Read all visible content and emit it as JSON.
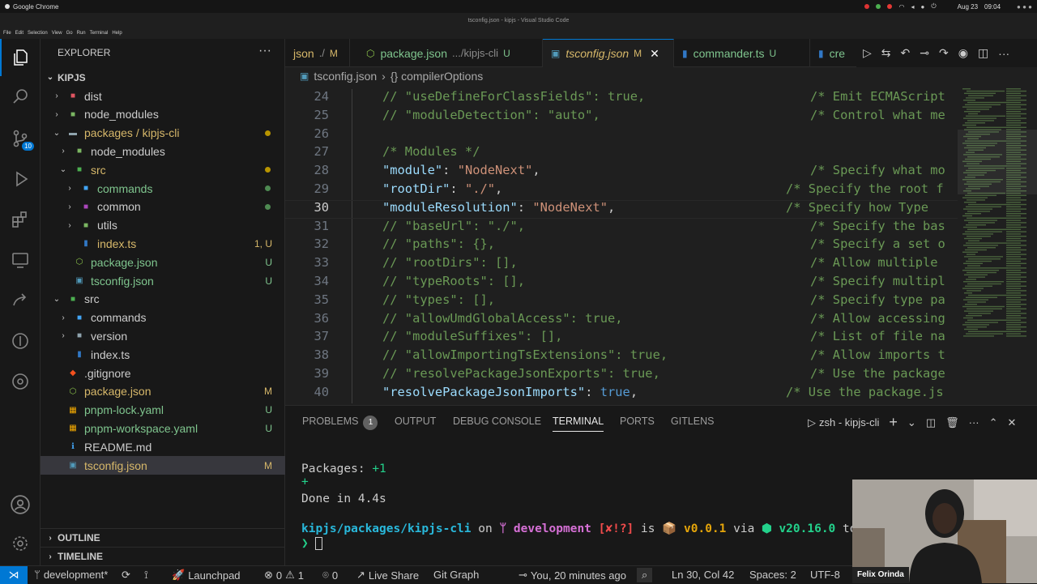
{
  "os": {
    "app": "Google Chrome",
    "date": "Aug 23",
    "time": "09:04"
  },
  "window_title": "tsconfig.json - kipjs - Visual Studio Code",
  "menu": [
    "File",
    "Edit",
    "Selection",
    "View",
    "Go",
    "Run",
    "Terminal",
    "Help"
  ],
  "activity": {
    "scm_badge": "10"
  },
  "explorer": {
    "title": "EXPLORER",
    "more": "···",
    "root": "KIPJS",
    "rows": [
      {
        "label": "dist",
        "depth": 1,
        "chev": "›",
        "icon": "folder-red",
        "color": "#cccccc",
        "status": ""
      },
      {
        "label": "node_modules",
        "depth": 1,
        "chev": "›",
        "icon": "folder-green",
        "color": "#cccccc",
        "status": ""
      },
      {
        "label": "packages / kipjs-cli",
        "depth": 1,
        "chev": "⌄",
        "icon": "folder-open",
        "color": "#d7b86a",
        "status": "dot"
      },
      {
        "label": "node_modules",
        "depth": 2,
        "chev": "›",
        "icon": "folder-green",
        "color": "#cccccc",
        "status": ""
      },
      {
        "label": "src",
        "depth": 2,
        "chev": "⌄",
        "icon": "folder-src",
        "color": "#d7b86a",
        "status": "dot"
      },
      {
        "label": "commands",
        "depth": 3,
        "chev": "›",
        "icon": "folder-blue",
        "color": "#7fc58e",
        "status": "dot-green"
      },
      {
        "label": "common",
        "depth": 3,
        "chev": "›",
        "icon": "folder-purple",
        "color": "#cccccc",
        "status": "dot-green"
      },
      {
        "label": "utils",
        "depth": 3,
        "chev": "›",
        "icon": "folder-green",
        "color": "#cccccc",
        "status": ""
      },
      {
        "label": "index.ts",
        "depth": 3,
        "chev": "",
        "icon": "ts",
        "color": "#d7b86a",
        "status": "1, U"
      },
      {
        "label": "package.json",
        "depth": 2,
        "chev": "",
        "icon": "nodejs",
        "color": "#7fc58e",
        "status": "U"
      },
      {
        "label": "tsconfig.json",
        "depth": 2,
        "chev": "",
        "icon": "tsconfig",
        "color": "#7fc58e",
        "status": "U"
      },
      {
        "label": "src",
        "depth": 1,
        "chev": "⌄",
        "icon": "folder-src",
        "color": "#cccccc",
        "status": ""
      },
      {
        "label": "commands",
        "depth": 2,
        "chev": "›",
        "icon": "folder-blue",
        "color": "#cccccc",
        "status": ""
      },
      {
        "label": "version",
        "depth": 2,
        "chev": "›",
        "icon": "folder-gray",
        "color": "#cccccc",
        "status": ""
      },
      {
        "label": "index.ts",
        "depth": 2,
        "chev": "",
        "icon": "ts",
        "color": "#cccccc",
        "status": ""
      },
      {
        "label": ".gitignore",
        "depth": 1,
        "chev": "",
        "icon": "git",
        "color": "#cccccc",
        "status": ""
      },
      {
        "label": "package.json",
        "depth": 1,
        "chev": "",
        "icon": "nodejs",
        "color": "#d7b86a",
        "status": "M"
      },
      {
        "label": "pnpm-lock.yaml",
        "depth": 1,
        "chev": "",
        "icon": "pnpm",
        "color": "#7fc58e",
        "status": "U"
      },
      {
        "label": "pnpm-workspace.yaml",
        "depth": 1,
        "chev": "",
        "icon": "pnpm",
        "color": "#7fc58e",
        "status": "U"
      },
      {
        "label": "README.md",
        "depth": 1,
        "chev": "",
        "icon": "info",
        "color": "#cccccc",
        "status": ""
      },
      {
        "label": "tsconfig.json",
        "depth": 1,
        "chev": "",
        "icon": "tsconfig",
        "color": "#d7b86a",
        "status": "M",
        "selected": true
      }
    ],
    "outline": "OUTLINE",
    "timeline": "TIMELINE"
  },
  "tabs": [
    {
      "label": "json",
      "detail": "./",
      "mark": "M",
      "icon": "",
      "active": false,
      "color": "#d7b86a"
    },
    {
      "label": "package.json",
      "detail": ".../kipjs-cli",
      "mark": "U",
      "icon": "nodejs",
      "active": false,
      "color": "#7fc58e"
    },
    {
      "label": "tsconfig.json",
      "detail": "",
      "mark": "M",
      "icon": "tsconfig",
      "active": true,
      "color": "#d7b86a"
    },
    {
      "label": "commander.ts",
      "detail": "",
      "mark": "U",
      "icon": "ts",
      "active": false,
      "color": "#7fc58e"
    },
    {
      "label": "cre",
      "detail": "",
      "mark": "",
      "icon": "ts",
      "active": false,
      "color": "#7fc58e"
    }
  ],
  "breadcrumb": {
    "file": "tsconfig.json",
    "sep": "›",
    "symbol": "{} compilerOptions"
  },
  "code": [
    {
      "n": "24",
      "type": "comment",
      "text": "// \"useDefineForClassFields\": true,",
      "c": "/* Emit ECMAScript"
    },
    {
      "n": "25",
      "type": "comment",
      "text": "// \"moduleDetection\": \"auto\",",
      "c": "/* Control what me"
    },
    {
      "n": "26",
      "type": "blank",
      "text": "",
      "c": ""
    },
    {
      "n": "27",
      "type": "comment",
      "text": "/* Modules */",
      "c": ""
    },
    {
      "n": "28",
      "type": "prop",
      "key": "\"module\"",
      "val": "\"NodeNext\"",
      "vtype": "s",
      "c": "/* Specify what mo"
    },
    {
      "n": "29",
      "type": "prop",
      "key": "\"rootDir\"",
      "val": "\"./\"",
      "vtype": "s",
      "c": "/* Specify the root f"
    },
    {
      "n": "30",
      "type": "prop",
      "key": "\"moduleResolution\"",
      "val": "\"NodeNext\"",
      "vtype": "s",
      "c": "/* Specify how Type"
    },
    {
      "n": "31",
      "type": "comment",
      "text": "// \"baseUrl\": \"./\",",
      "c": "/* Specify the bas"
    },
    {
      "n": "32",
      "type": "comment",
      "text": "// \"paths\": {},",
      "c": "/* Specify a set o"
    },
    {
      "n": "33",
      "type": "comment",
      "text": "// \"rootDirs\": [],",
      "c": "/* Allow multiple"
    },
    {
      "n": "34",
      "type": "comment",
      "text": "// \"typeRoots\": [],",
      "c": "/* Specify multipl"
    },
    {
      "n": "35",
      "type": "comment",
      "text": "// \"types\": [],",
      "c": "/* Specify type pa"
    },
    {
      "n": "36",
      "type": "comment",
      "text": "// \"allowUmdGlobalAccess\": true,",
      "c": "/* Allow accessing"
    },
    {
      "n": "37",
      "type": "comment",
      "text": "// \"moduleSuffixes\": [],",
      "c": "/* List of file na"
    },
    {
      "n": "38",
      "type": "comment",
      "text": "// \"allowImportingTsExtensions\": true,",
      "c": "/* Allow imports t"
    },
    {
      "n": "39",
      "type": "comment",
      "text": "// \"resolvePackageJsonExports\": true,",
      "c": "/* Use the package"
    },
    {
      "n": "40",
      "type": "prop",
      "key": "\"resolvePackageJsonImports\"",
      "val": "true",
      "vtype": "b",
      "c": "/* Use the package.js"
    }
  ],
  "current_line": "30",
  "panel": {
    "tabs": [
      "PROBLEMS",
      "OUTPUT",
      "DEBUG CONSOLE",
      "TERMINAL",
      "PORTS",
      "GITLENS"
    ],
    "problems_count": "1",
    "active": "TERMINAL",
    "terminal_name": "zsh - kipjs-cli",
    "lines": {
      "packages": "Packages: ",
      "packages_val": "+1",
      "plus": "+",
      "done": "Done in 4.4s",
      "prompt_path": "kipjs/packages/kipjs-cli",
      "on": " on ",
      "branch": "development",
      "git_status": "[✘!?]",
      "is": " is ",
      "version": "v0.0.1",
      "via": " via ",
      "node": "v20.16.0",
      "took": " took",
      "caret": "❯"
    }
  },
  "status": {
    "branch": "development*",
    "launchpad": "Launchpad",
    "errors": "0",
    "warnings": "1",
    "ports": "0",
    "live_share": "Live Share",
    "git_graph": "Git Graph",
    "blame": "You, 20 minutes ago",
    "position": "Ln 30, Col 42",
    "spaces": "Spaces: 2",
    "encoding": "UTF-8"
  },
  "webcam": {
    "name": "Felix Orinda"
  }
}
